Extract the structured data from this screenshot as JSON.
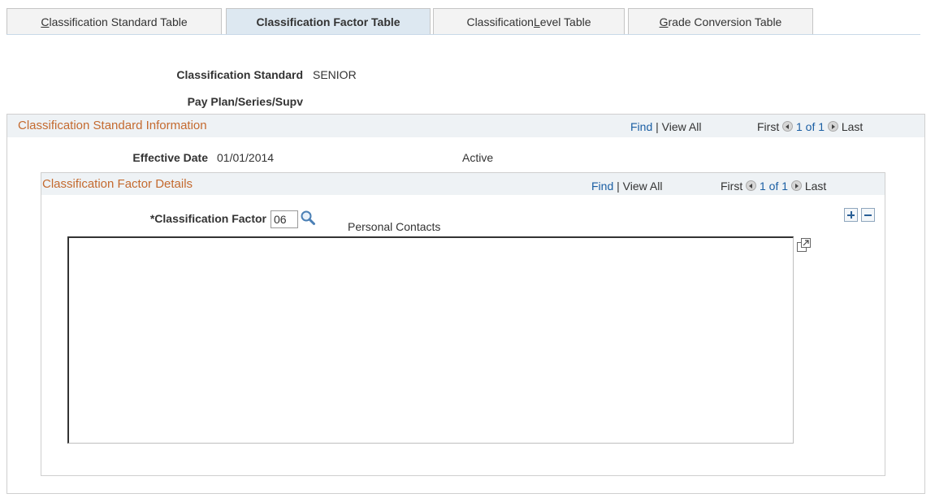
{
  "tabs": [
    {
      "underline": "C",
      "rest": "lassification Standard Table"
    },
    {
      "label": "Classification Factor Table"
    },
    {
      "pre": "Classification ",
      "underline": "L",
      "rest": "evel Table"
    },
    {
      "underline": "G",
      "rest": "rade Conversion Table"
    }
  ],
  "header": {
    "class_std_label": "Classification Standard",
    "class_std_value": "SENIOR",
    "pay_plan_label": "Pay Plan/Series/Supv"
  },
  "std_info": {
    "title": "Classification Standard Information",
    "find": "Find",
    "sep": "|",
    "view_all": "View All",
    "first": "First",
    "count": "1 of 1",
    "last": "Last",
    "eff_date_label": "Effective Date",
    "eff_date_value": "01/01/2014",
    "status": "Active"
  },
  "factor_details": {
    "title": "Classification Factor Details",
    "find": "Find",
    "sep": "|",
    "view_all": "View All",
    "first": "First",
    "count": "1 of 1",
    "last": "Last",
    "factor_label": "*Classification Factor",
    "factor_value": "06",
    "factor_desc": "Personal Contacts",
    "textarea_value": ""
  },
  "colors": {
    "section_title": "#c46a2f",
    "link": "#1a5ea3",
    "active_tab": "#dde8f1",
    "header_band": "#eef2f5"
  },
  "icons": {
    "lookup": "magnifier-icon",
    "add_row": "plus-icon",
    "delete_row": "minus-icon",
    "expand": "expand-textarea-icon",
    "prev": "arrow-left-icon",
    "next": "arrow-right-icon"
  }
}
